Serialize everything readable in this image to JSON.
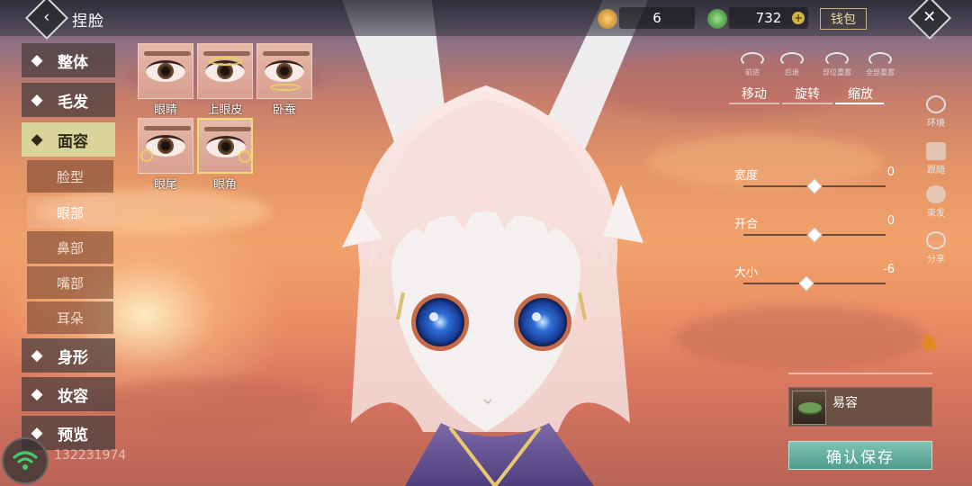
{
  "topbar": {
    "title": "捏脸",
    "currency1_value": "6",
    "currency2_value": "732",
    "wallet_label": "钱包"
  },
  "left_menu": {
    "items": [
      {
        "label": "整体",
        "icon": "body-outline-icon"
      },
      {
        "label": "毛发",
        "icon": "hair-icon"
      },
      {
        "label": "面容",
        "icon": "face-icon"
      },
      {
        "label": "身形",
        "icon": "figure-icon"
      },
      {
        "label": "妆容",
        "icon": "makeup-icon"
      },
      {
        "label": "预览",
        "icon": "preview-icon"
      }
    ],
    "active": "面容",
    "submenu": [
      "脸型",
      "眼部",
      "鼻部",
      "嘴部",
      "耳朵"
    ],
    "active_sub": "眼部"
  },
  "eye_options": [
    {
      "label": "眼睛"
    },
    {
      "label": "上眼皮"
    },
    {
      "label": "卧蚕"
    },
    {
      "label": "眼尾"
    },
    {
      "label": "眼角",
      "selected": true
    }
  ],
  "controls": {
    "undo_label": "前进",
    "redo_label": "后退",
    "reset_part_label": "部位重置",
    "reset_all_label": "全部重置"
  },
  "transform_tabs": [
    {
      "label": "移动"
    },
    {
      "label": "旋转"
    },
    {
      "label": "缩放",
      "active": true
    }
  ],
  "sliders": [
    {
      "label": "宽度",
      "value": 0,
      "value_text": "0",
      "fraction": 0.5
    },
    {
      "label": "开合",
      "value": 0,
      "value_text": "0",
      "fraction": 0.5
    },
    {
      "label": "大小",
      "value": -6,
      "value_text": "-6",
      "fraction": 0.44
    }
  ],
  "side_buttons": [
    {
      "label": "环境",
      "icon": "environment-icon"
    },
    {
      "label": "跟随",
      "icon": "camera-icon"
    },
    {
      "label": "束发",
      "icon": "hair-tie-icon"
    },
    {
      "label": "分享",
      "icon": "share-icon"
    }
  ],
  "yirong_label": "易容",
  "save_label": "确认保存",
  "uid_text": "132231974",
  "colors": {
    "menu_active": "#d9d49a",
    "save_button": "#5fae9e",
    "thumb_selected_border": "#f0dc78"
  }
}
